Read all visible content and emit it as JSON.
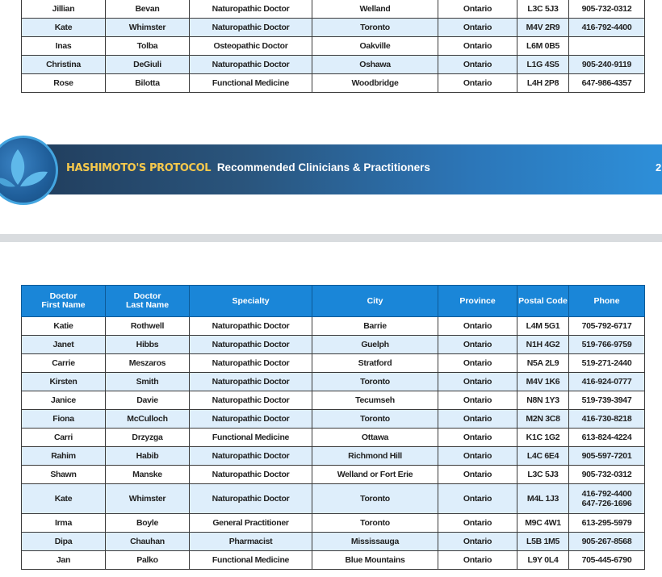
{
  "top_table": {
    "rows": [
      {
        "first": "Jillian",
        "last": "Bevan",
        "specialty": "Naturopathic Doctor",
        "city": "Welland",
        "province": "Ontario",
        "postal": "L3C 5J3",
        "phone": "905-732-0312"
      },
      {
        "first": "Kate",
        "last": "Whimster",
        "specialty": "Naturopathic Doctor",
        "city": "Toronto",
        "province": "Ontario",
        "postal": "M4V 2R9",
        "phone": "416-792-4400"
      },
      {
        "first": "Inas",
        "last": "Tolba",
        "specialty": "Osteopathic Doctor",
        "city": "Oakville",
        "province": "Ontario",
        "postal": "L6M 0B5",
        "phone": ""
      },
      {
        "first": "Christina",
        "last": "DeGiuli",
        "specialty": "Naturopathic Doctor",
        "city": "Oshawa",
        "province": "Ontario",
        "postal": "L1G 4S5",
        "phone": "905-240-9119"
      },
      {
        "first": "Rose",
        "last": "Bilotta",
        "specialty": "Functional Medicine",
        "city": "Woodbridge",
        "province": "Ontario",
        "postal": "L4H 2P8",
        "phone": "647-986-4357"
      }
    ]
  },
  "banner": {
    "brand": "HASHIMOTO'S PROTOCOL",
    "subtitle": "Recommended Clinicians & Practitioners",
    "page_number": "2",
    "bar_color": "#2d8fd9",
    "logo_icon": "leaf-logo-icon"
  },
  "bottom_table": {
    "headers": {
      "first_line1": "Doctor",
      "first_line2": "First Name",
      "last_line1": "Doctor",
      "last_line2": "Last Name",
      "specialty": "Specialty",
      "city": "City",
      "province": "Province",
      "postal": "Postal Code",
      "phone": "Phone"
    },
    "rows": [
      {
        "first": "Katie",
        "last": "Rothwell",
        "specialty": "Naturopathic Doctor",
        "city": "Barrie",
        "province": "Ontario",
        "postal": "L4M 5G1",
        "phone": "705-792-6717"
      },
      {
        "first": "Janet",
        "last": "Hibbs",
        "specialty": "Naturopathic Doctor",
        "city": "Guelph",
        "province": "Ontario",
        "postal": "N1H 4G2",
        "phone": "519-766-9759"
      },
      {
        "first": "Carrie",
        "last": "Meszaros",
        "specialty": "Naturopathic Doctor",
        "city": "Stratford",
        "province": "Ontario",
        "postal": "N5A 2L9",
        "phone": "519-271-2440"
      },
      {
        "first": "Kirsten",
        "last": "Smith",
        "specialty": "Naturopathic Doctor",
        "city": "Toronto",
        "province": "Ontario",
        "postal": "M4V 1K6",
        "phone": "416-924-0777"
      },
      {
        "first": "Janice",
        "last": "Davie",
        "specialty": "Naturopathic Doctor",
        "city": "Tecumseh",
        "province": "Ontario",
        "postal": "N8N 1Y3",
        "phone": "519-739-3947"
      },
      {
        "first": "Fiona",
        "last": "McCulloch",
        "specialty": "Naturopathic Doctor",
        "city": "Toronto",
        "province": "Ontario",
        "postal": "M2N 3C8",
        "phone": "416-730-8218"
      },
      {
        "first": "Carri",
        "last": "Drzyzga",
        "specialty": "Functional Medicine",
        "city": "Ottawa",
        "province": "Ontario",
        "postal": "K1C 1G2",
        "phone": "613-824-4224"
      },
      {
        "first": "Rahim",
        "last": "Habib",
        "specialty": "Naturopathic Doctor",
        "city": "Richmond Hill",
        "province": "Ontario",
        "postal": "L4C 6E4",
        "phone": "905-597-7201"
      },
      {
        "first": "Shawn",
        "last": "Manske",
        "specialty": "Naturopathic Doctor",
        "city": "Welland or Fort Erie",
        "province": "Ontario",
        "postal": "L3C 5J3",
        "phone": "905-732-0312"
      },
      {
        "first": "Kate",
        "last": "Whimster",
        "specialty": "Naturopathic Doctor",
        "city": "Toronto",
        "province": "Ontario",
        "postal": "M4L 1J3",
        "phone": "416-792-4400",
        "phone2": "647-726-1696"
      },
      {
        "first": "Irma",
        "last": "Boyle",
        "specialty": "General Practitioner",
        "city": "Toronto",
        "province": "Ontario",
        "postal": "M9C 4W1",
        "phone": "613-295-5979"
      },
      {
        "first": "Dipa",
        "last": "Chauhan",
        "specialty": "Pharmacist",
        "city": "Mississauga",
        "province": "Ontario",
        "postal": "L5B 1M5",
        "phone": "905-267-8568"
      },
      {
        "first": "Jan",
        "last": "Palko",
        "specialty": "Functional Medicine",
        "city": "Blue Mountains",
        "province": "Ontario",
        "postal": "L9Y 0L4",
        "phone": "705-445-6790"
      }
    ]
  }
}
